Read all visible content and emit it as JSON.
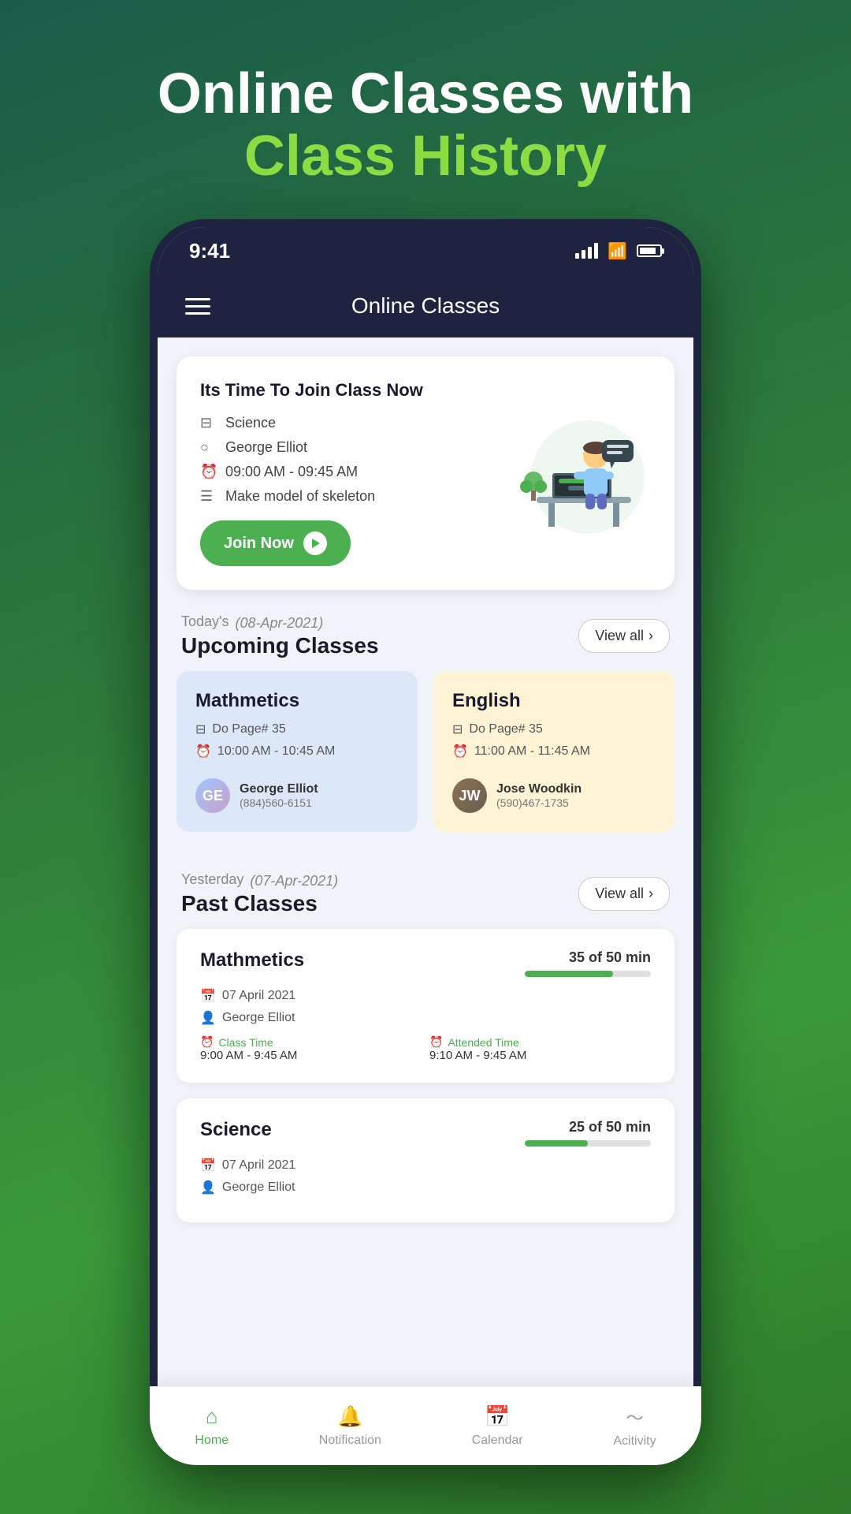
{
  "hero": {
    "line1": "Online Classes with",
    "line2": "Class History"
  },
  "status_bar": {
    "time": "9:41"
  },
  "header": {
    "title": "Online Classes"
  },
  "join_card": {
    "title": "Its Time To Join Class Now",
    "subject": "Science",
    "teacher": "George Elliot",
    "time": "09:00 AM  - 09:45 AM",
    "task": "Make model of skeleton",
    "button": "Join Now"
  },
  "upcoming": {
    "label": "Today's",
    "date": "(08-Apr-2021)",
    "title": "Upcoming Classes",
    "view_all": "View all",
    "classes": [
      {
        "name": "Mathmetics",
        "task": "Do Page# 35",
        "time": "10:00 AM - 10:45 AM",
        "teacher_name": "George Elliot",
        "teacher_phone": "(884)560-6151"
      },
      {
        "name": "English",
        "task": "Do Page# 35",
        "time": "11:00 AM - 11:45 AM",
        "teacher_name": "Jose Woodkin",
        "teacher_phone": "(590)467-1735"
      }
    ]
  },
  "past": {
    "label": "Yesterday",
    "date": "(07-Apr-2021)",
    "title": "Past Classes",
    "view_all": "View all",
    "classes": [
      {
        "name": "Mathmetics",
        "date": "07 April 2021",
        "teacher": "George Elliot",
        "class_time_label": "Class Time",
        "class_time": "9:00 AM - 9:45 AM",
        "attended_time_label": "Attended Time",
        "attended_time": "9:10 AM - 9:45 AM",
        "progress_label": "35 of 50 min",
        "progress_pct": 70
      },
      {
        "name": "Science",
        "date": "07 April 2021",
        "teacher": "George Elliot",
        "progress_label": "25 of 50 min",
        "progress_pct": 50
      }
    ]
  },
  "bottom_nav": {
    "items": [
      {
        "label": "Home",
        "icon": "⌂",
        "active": true
      },
      {
        "label": "Notification",
        "icon": "🔔",
        "active": false
      },
      {
        "label": "Calendar",
        "icon": "📅",
        "active": false
      },
      {
        "label": "Acitivity",
        "icon": "〜",
        "active": false
      }
    ]
  }
}
